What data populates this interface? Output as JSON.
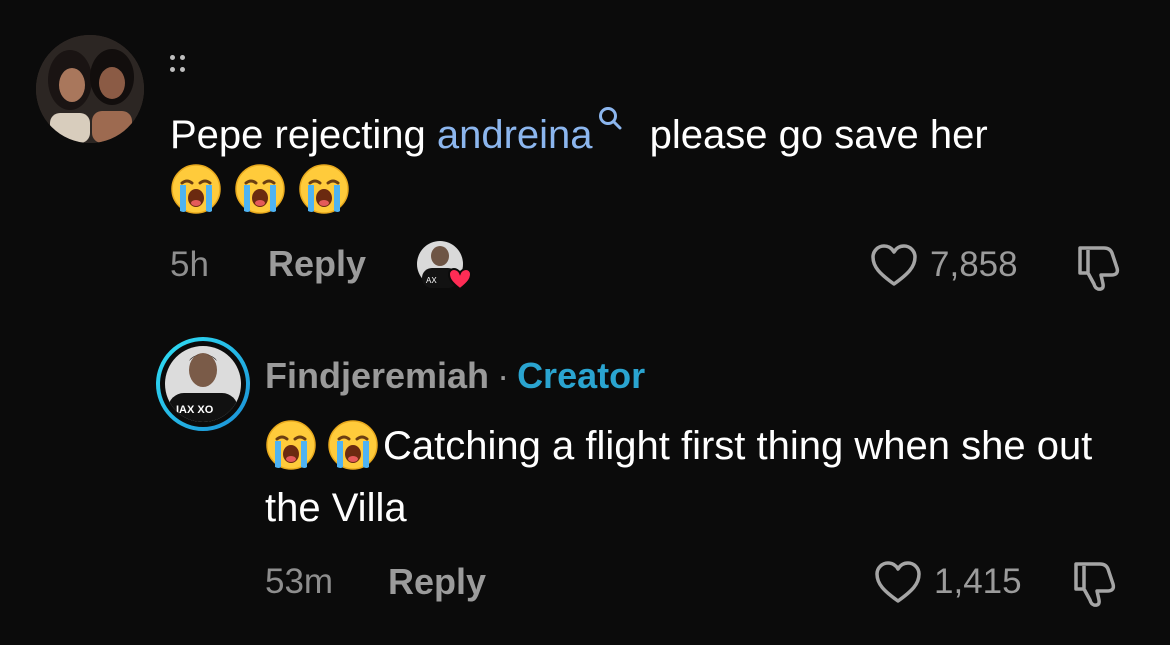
{
  "comment1": {
    "text_before": "Pepe rejecting ",
    "mention": "andreina",
    "text_after": " please go save her",
    "emoji_count": 3,
    "time": "5h",
    "reply_label": "Reply",
    "likes": "7,858"
  },
  "comment2": {
    "author": "Findjeremiah",
    "separator": "·",
    "badge": "Creator",
    "text": "Catching a flight first thing when she out the Villa",
    "time": "53m",
    "reply_label": "Reply",
    "likes": "1,415"
  },
  "colors": {
    "background": "#0b0b0b",
    "mention": "#8cb6ee",
    "creator_badge": "#2aa4d0",
    "heart_badge": "#fe2c55"
  },
  "icons": [
    "loudly-crying-face-emoji",
    "search-icon",
    "heart-icon",
    "dislike-icon",
    "drag-handle-icon"
  ]
}
